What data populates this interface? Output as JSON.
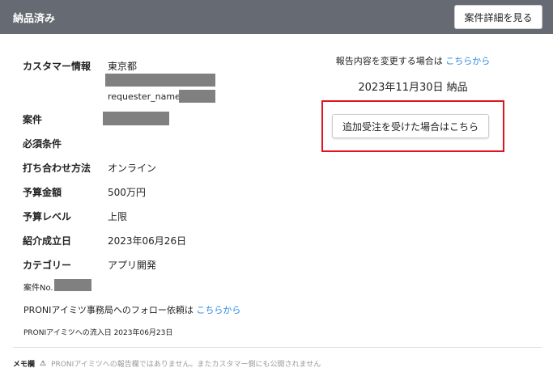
{
  "header": {
    "title": "納品済み",
    "detail_button": "案件詳細を見る"
  },
  "fields": {
    "customer_label": "カスタマー情報",
    "customer_pref": "東京都",
    "customer_requester": "requester_name_",
    "case_label": "案件",
    "required_label": "必須条件",
    "meeting_label": "打ち合わせ方法",
    "meeting_value": "オンライン",
    "budget_label": "予算金額",
    "budget_value": "500万円",
    "budget_level_label": "予算レベル",
    "budget_level_value": "上限",
    "intro_date_label": "紹介成立日",
    "intro_date_value": "2023年06月26日",
    "category_label": "カテゴリー",
    "category_value": "アプリ開発",
    "case_no_label": "案件No.",
    "follow_text": "PRONIアイミツ事務局へのフォロー依頼は",
    "follow_link": "こちらから",
    "inflow_text": "PRONIアイミツへの流入日 2023年06月23日"
  },
  "right": {
    "change_text": "報告内容を変更する場合は",
    "change_link": "こちらから",
    "delivery": "2023年11月30日 納品",
    "add_order_button": "追加受注を受けた場合はこちら"
  },
  "memo": {
    "label": "メモ欄",
    "icon": "warning-icon",
    "note": "PRONIアイミツへの報告欄ではありません。またカスタマー側にも公開されません"
  }
}
